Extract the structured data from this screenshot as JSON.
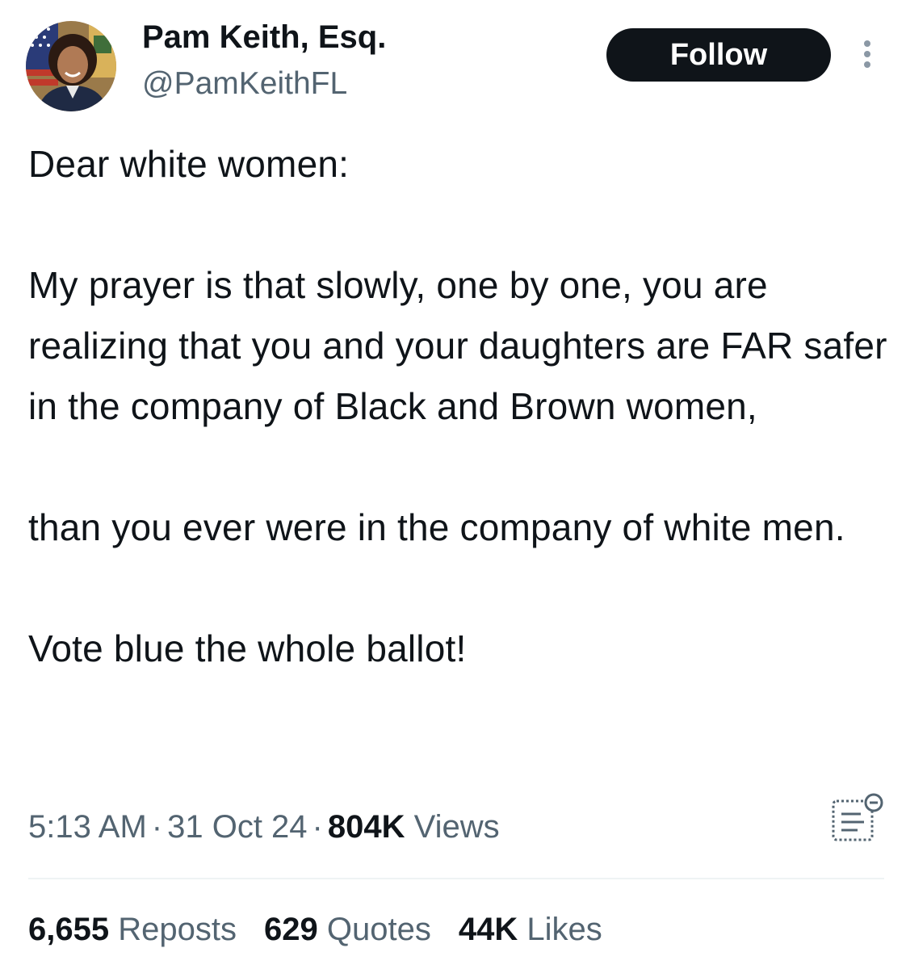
{
  "author": {
    "display_name": "Pam Keith, Esq.",
    "handle": "@PamKeithFL"
  },
  "follow_label": "Follow",
  "tweet": {
    "text": "Dear white women:\n\nMy prayer is that slowly, one by one, you are realizing that you and your daughters are FAR safer in the company of Black and Brown women,\n\nthan you ever were in the company of white men.\n\nVote blue the whole ballot!"
  },
  "meta": {
    "time": "5:13 AM",
    "date": "31 Oct 24",
    "separator": "·",
    "views_count": "804K",
    "views_label": "Views"
  },
  "stats": [
    {
      "count": "6,655",
      "label": "Reposts"
    },
    {
      "count": "629",
      "label": "Quotes"
    },
    {
      "count": "44K",
      "label": "Likes"
    }
  ],
  "icons": {
    "more": "more-vertical-icon",
    "analytics": "analytics-icon"
  },
  "colors": {
    "primary_text": "#0f1419",
    "secondary_text": "#536471",
    "follow_button_bg": "#0f1419",
    "divider": "#eff3f4"
  }
}
